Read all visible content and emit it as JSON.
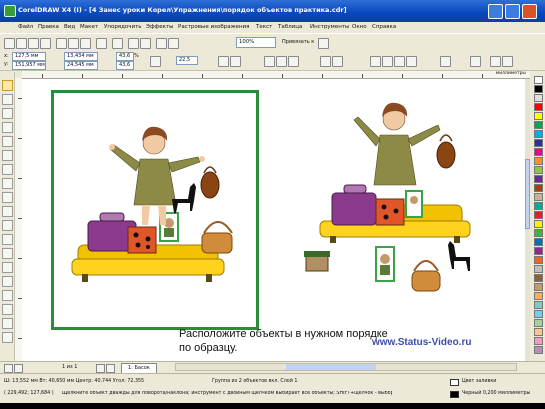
{
  "window": {
    "title": "CorelDRAW X4 (I) - [4 Занес уроки Корел\\Упражнения\\порядок объектов практика.cdr]"
  },
  "menu": [
    "Файл",
    "Правка",
    "Вид",
    "Макет",
    "Упорядочить",
    "Эффекты",
    "Растровые изображения",
    "Текст",
    "Таблица",
    "Инструменты",
    "Окно",
    "Справка"
  ],
  "toolbar": {
    "zoom_value": "100%",
    "snap_label": "Привязать к"
  },
  "propbar": {
    "x": "127,5 мм",
    "y": "151,957 мм",
    "w": "13,434 мм",
    "h": "24,545 мм",
    "scale_x": "43,6",
    "scale_y": "43,6",
    "percent": "%",
    "angle": "22,5"
  },
  "ruler": {
    "unit": "миллиметры"
  },
  "canvas": {
    "hint_line1": "Расположите объекты в нужном порядке",
    "hint_line2": "по образцу.",
    "watermark": "www.Status-Video.ru"
  },
  "page_tabs": {
    "counter": "1 из 1",
    "tab_label": "1: Басок"
  },
  "status": {
    "size_text": "Ш: 13,552 мм Вт: 40,650 мм  Центр: 40,744 Угол: 72,355",
    "group_text": "Группа из 2 объектов вкл. Слой 1",
    "coords": "( 229,492; 127,684 )",
    "hint": "Щелкните объект дважды для поворота/наклона; инструмент с двойным щелчком выбирает все объекты; SHIFT+щелчок - выбор...",
    "fill_label": "Цвет заливки",
    "outline_label": "Черный  0,200 миллиметры"
  },
  "palette_colors": [
    "#ffffff",
    "#000000",
    "#e0e0e0",
    "#ff0000",
    "#ffff00",
    "#00a651",
    "#00aeef",
    "#2e3192",
    "#ec008c",
    "#f7941d",
    "#8dc63f",
    "#662d91",
    "#a0410d",
    "#c7b299",
    "#00a99d",
    "#ed1c24",
    "#fff200",
    "#39b54a",
    "#0072bc",
    "#92278f",
    "#f26522",
    "#bfbfbf",
    "#8c6239",
    "#c69c6d",
    "#fbaf5d",
    "#7accc8",
    "#6dcff6",
    "#a3d39c",
    "#fdc689",
    "#f49ac2",
    "#bd8cbf"
  ]
}
